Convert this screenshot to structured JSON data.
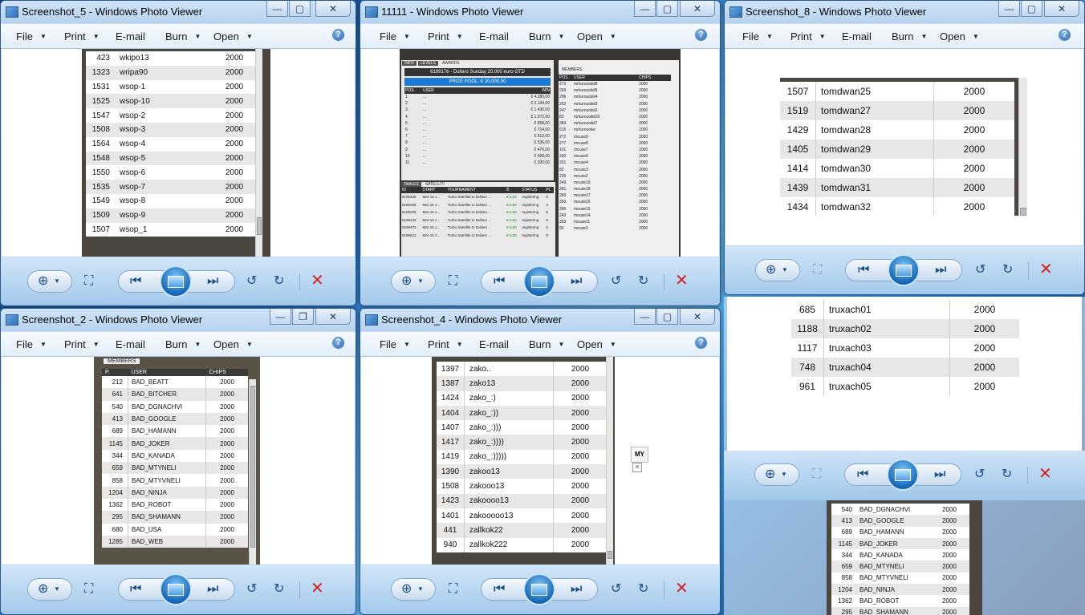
{
  "menu": {
    "file": "File",
    "print": "Print",
    "email": "E-mail",
    "burn": "Burn",
    "open": "Open"
  },
  "help_glyph": "?",
  "windows": [
    {
      "title": "Screenshot_5 - Windows Photo Viewer",
      "rows": [
        [
          "423",
          "wkipo13",
          "2000"
        ],
        [
          "1323",
          "wripa90",
          "2000"
        ],
        [
          "1531",
          "wsop-1",
          "2000"
        ],
        [
          "1525",
          "wsop-10",
          "2000"
        ],
        [
          "1547",
          "wsop-2",
          "2000"
        ],
        [
          "1508",
          "wsop-3",
          "2000"
        ],
        [
          "1564",
          "wsop-4",
          "2000"
        ],
        [
          "1548",
          "wsop-5",
          "2000"
        ],
        [
          "1550",
          "wsop-6",
          "2000"
        ],
        [
          "1535",
          "wsop-7",
          "2000"
        ],
        [
          "1549",
          "wsop-8",
          "2000"
        ],
        [
          "1509",
          "wsop-9",
          "2000"
        ],
        [
          "1507",
          "wsop_1",
          "2000"
        ]
      ]
    },
    {
      "title": "11111 - Windows Photo Viewer",
      "header": "6199176 - Dollaro Sunday 20.000 euro GTD",
      "prize": "PRIZE POOL: € 20.000,00",
      "tabs": [
        "INFO",
        "LEVELS",
        "AWARDS"
      ],
      "members_tab": "MEMBERS",
      "member_cols": [
        "POS.",
        "USER",
        "CHIPS"
      ],
      "awards_cols": [
        "POS.",
        "USER",
        "WIN"
      ],
      "awards": [
        [
          "1",
          "...",
          "€ 4.280,00"
        ],
        [
          "2",
          "...",
          "€ 2.144,00"
        ],
        [
          "3",
          "...",
          "€ 1.430,00"
        ],
        [
          "4",
          "...",
          "€ 1.072,00"
        ],
        [
          "5",
          "...",
          "€ 858,00"
        ],
        [
          "6",
          "...",
          "€ 714,00"
        ],
        [
          "7",
          "...",
          "€ 612,00"
        ],
        [
          "8",
          "...",
          "€ 536,00"
        ],
        [
          "9",
          "...",
          "€ 476,00"
        ],
        [
          "10",
          "...",
          "€ 428,00"
        ],
        [
          "11",
          "...",
          "€ 390,00"
        ]
      ],
      "members": [
        [
          "273",
          "mrkurouiskii8",
          "2000"
        ],
        [
          "269",
          "mrkurouiskii5",
          "2000"
        ],
        [
          "296",
          "mrkurouiskii4",
          "2000"
        ],
        [
          "252",
          "mrkurouiskii3",
          "2000"
        ],
        [
          "247",
          "mrkurouiskii2",
          "2000"
        ],
        [
          "83",
          "mrkurouiskii10",
          "2000"
        ],
        [
          "384",
          "mrkurouiskii7",
          "2000"
        ],
        [
          "515",
          "mrkurouiskii",
          "2000"
        ],
        [
          "272",
          "mouse9",
          "2000"
        ],
        [
          "277",
          "mouse8",
          "2000"
        ],
        [
          "101",
          "mouse7",
          "2000"
        ],
        [
          "330",
          "mouse6",
          "2000"
        ],
        [
          "331",
          "mouse4",
          "2000"
        ],
        [
          "82",
          "mouse3",
          "2000"
        ],
        [
          "235",
          "mouse2",
          "2000"
        ],
        [
          "249",
          "mouse19",
          "2000"
        ],
        [
          "281",
          "mouse18",
          "2000"
        ],
        [
          "283",
          "mouse17",
          "2000"
        ],
        [
          "303",
          "mouse16",
          "2000"
        ],
        [
          "396",
          "mouse15",
          "2000"
        ],
        [
          "243",
          "mouse14",
          "2000"
        ],
        [
          "393",
          "mouse11",
          "2000"
        ],
        [
          "90",
          "mouse1",
          "2000"
        ]
      ],
      "sat_tabs": [
        "TABLES",
        "SATELLITI"
      ],
      "sat_cols": [
        "ID",
        "START",
        "TOURNAMENT",
        "B",
        "STATUS",
        "PL"
      ],
      "sats": [
        [
          "6199339",
          "Mar-15 1...",
          "Turbo Satellite to Dollaro ...",
          "€ 5,50",
          "registering",
          "0"
        ],
        [
          "6199438",
          "Mar-15 1...",
          "Turbo Satellite to Dollaro ...",
          "€ 5,50",
          "registering",
          "4"
        ],
        [
          "6199439",
          "Mar-15 1...",
          "Turbo Satellite to Dollaro ...",
          "€ 5,50",
          "registering",
          "5"
        ],
        [
          "6199442",
          "Mar-15 1...",
          "Turbo Satellite to Dollaro ...",
          "€ 5,50",
          "registering",
          "5"
        ],
        [
          "6199470",
          "Mar-15 1...",
          "Turbo Satellite to Dollaro ...",
          "€ 5,50",
          "registering",
          "0"
        ],
        [
          "6199621",
          "Mar-15 2...",
          "Turbo Satellite to Dollaro ...",
          "€ 5,50",
          "registering",
          "8"
        ]
      ]
    },
    {
      "title": "Screenshot_8 - Windows Photo Viewer",
      "rows": [
        [
          "1507",
          "tomdwan25",
          "2000"
        ],
        [
          "1519",
          "tomdwan27",
          "2000"
        ],
        [
          "1429",
          "tomdwan28",
          "2000"
        ],
        [
          "1405",
          "tomdwan29",
          "2000"
        ],
        [
          "1414",
          "tomdwan30",
          "2000"
        ],
        [
          "1439",
          "tomdwan31",
          "2000"
        ],
        [
          "1434",
          "tomdwan32",
          "2000"
        ]
      ]
    },
    {
      "title": "Screenshot_2 - Windows Photo Viewer",
      "members_tab": "MEMBERS",
      "cols": [
        "P.",
        "USER",
        "CHIPS"
      ],
      "rows": [
        [
          "212",
          "BAD_BEATT",
          "2000"
        ],
        [
          "641",
          "BAD_BITCHER",
          "2000"
        ],
        [
          "540",
          "BAD_DGNACHVI",
          "2000"
        ],
        [
          "413",
          "BAD_GOOGLE",
          "2000"
        ],
        [
          "689",
          "BAD_HAMANN",
          "2000"
        ],
        [
          "1145",
          "BAD_JOKER",
          "2000"
        ],
        [
          "344",
          "BAD_KANADA",
          "2000"
        ],
        [
          "659",
          "BAD_MTYNELI",
          "2000"
        ],
        [
          "858",
          "BAD_MTYVNELI",
          "2000"
        ],
        [
          "1204",
          "BAD_NINJA",
          "2000"
        ],
        [
          "1362",
          "BAD_ROBOT",
          "2000"
        ],
        [
          "295",
          "BAD_SHAMANN",
          "2000"
        ],
        [
          "680",
          "BAD_USA",
          "2000"
        ],
        [
          "1285",
          "BAD_WEB",
          "2000"
        ]
      ]
    },
    {
      "title": "Screenshot_4 - Windows Photo Viewer",
      "side_label": "MY",
      "rows": [
        [
          "1397",
          "zako..",
          "2000"
        ],
        [
          "1387",
          "zako13",
          "2000"
        ],
        [
          "1424",
          "zako_:)",
          "2000"
        ],
        [
          "1404",
          "zako_:))",
          "2000"
        ],
        [
          "1407",
          "zako_:)))",
          "2000"
        ],
        [
          "1417",
          "zako_:))))",
          "2000"
        ],
        [
          "1419",
          "zako_:)))))",
          "2000"
        ],
        [
          "1390",
          "zakoo13",
          "2000"
        ],
        [
          "1508",
          "zakooo13",
          "2000"
        ],
        [
          "1423",
          "zakoooo13",
          "2000"
        ],
        [
          "1401",
          "zakooooo13",
          "2000"
        ],
        [
          "441",
          "zallkok22",
          "2000"
        ],
        [
          "940",
          "zallkok222",
          "2000"
        ]
      ]
    }
  ],
  "truxach_rows": [
    [
      "685",
      "truxach01",
      "2000"
    ],
    [
      "1188",
      "truxach02",
      "2000"
    ],
    [
      "1117",
      "truxach03",
      "2000"
    ],
    [
      "748",
      "truxach04",
      "2000"
    ],
    [
      "961",
      "truxach05",
      "2000"
    ]
  ],
  "bottom_rows": [
    [
      "540",
      "BAD_DGNACHVI",
      "2000"
    ],
    [
      "413",
      "BAD_GOOGLE",
      "2000"
    ],
    [
      "689",
      "BAD_HAMANN",
      "2000"
    ],
    [
      "1145",
      "BAD_JOKER",
      "2000"
    ],
    [
      "344",
      "BAD_KANADA",
      "2000"
    ],
    [
      "659",
      "BAD_MTYNELI",
      "2000"
    ],
    [
      "858",
      "BAD_MTYVNELI",
      "2000"
    ],
    [
      "1204",
      "BAD_NINJA",
      "2000"
    ],
    [
      "1362",
      "BAD_ROBOT",
      "2000"
    ],
    [
      "295",
      "BAD_SHAMANN",
      "2000"
    ]
  ],
  "icons": {
    "zoom": "magnifier-icon",
    "fit": "fit-icon",
    "prev": "previous-icon",
    "slideshow": "slideshow-icon",
    "next": "next-icon",
    "rotate_ccw": "rotate-ccw-icon",
    "rotate_cw": "rotate-cw-icon",
    "delete": "delete-icon"
  }
}
